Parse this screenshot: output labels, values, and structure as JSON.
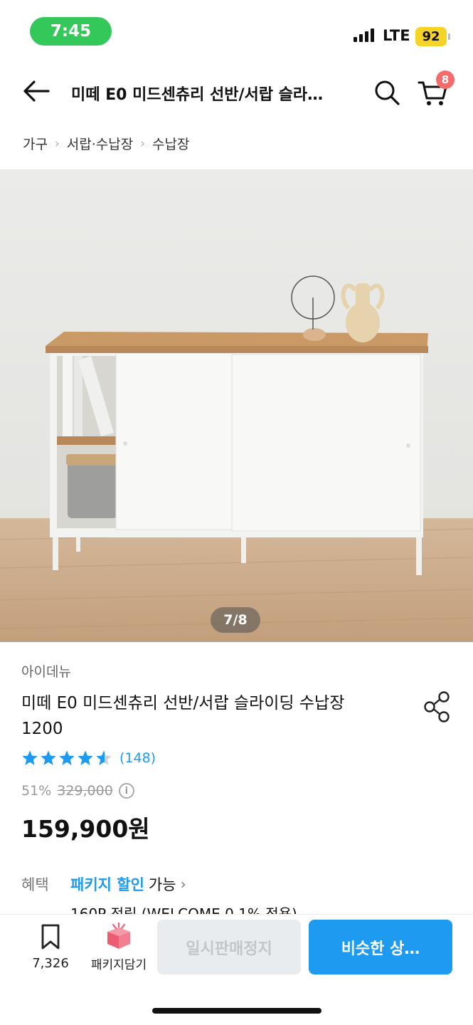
{
  "status_bar": {
    "time": "7:45",
    "network": "LTE",
    "battery": "92"
  },
  "header": {
    "title": "미떼 E0 미드센츄리 선반/서랍 슬라…",
    "cart_count": "8"
  },
  "breadcrumb": [
    "가구",
    "서랍·수납장",
    "수납장"
  ],
  "gallery": {
    "counter": "7/8"
  },
  "product": {
    "brand": "아이데뉴",
    "name": "미떼 E0 미드센츄리 선반/서랍 슬라이딩 수납장 1200",
    "rating": 4.5,
    "review_count": "(148)",
    "discount": "51%",
    "original_price": "329,000",
    "price": "159,900원"
  },
  "benefit": {
    "label": "혜택",
    "highlight": "패키지 할인",
    "text": "가능",
    "line2": "160P 적립 (WELCOME 0.1% 적용)"
  },
  "bottom_bar": {
    "bookmark_count": "7,326",
    "package_label": "패키지담기",
    "suspended_label": "일시판매정지",
    "similar_label": "비슷한 상…"
  },
  "colors": {
    "accent": "#1e9bf0",
    "status_green": "#34c759",
    "badge": "#f66b6b"
  }
}
